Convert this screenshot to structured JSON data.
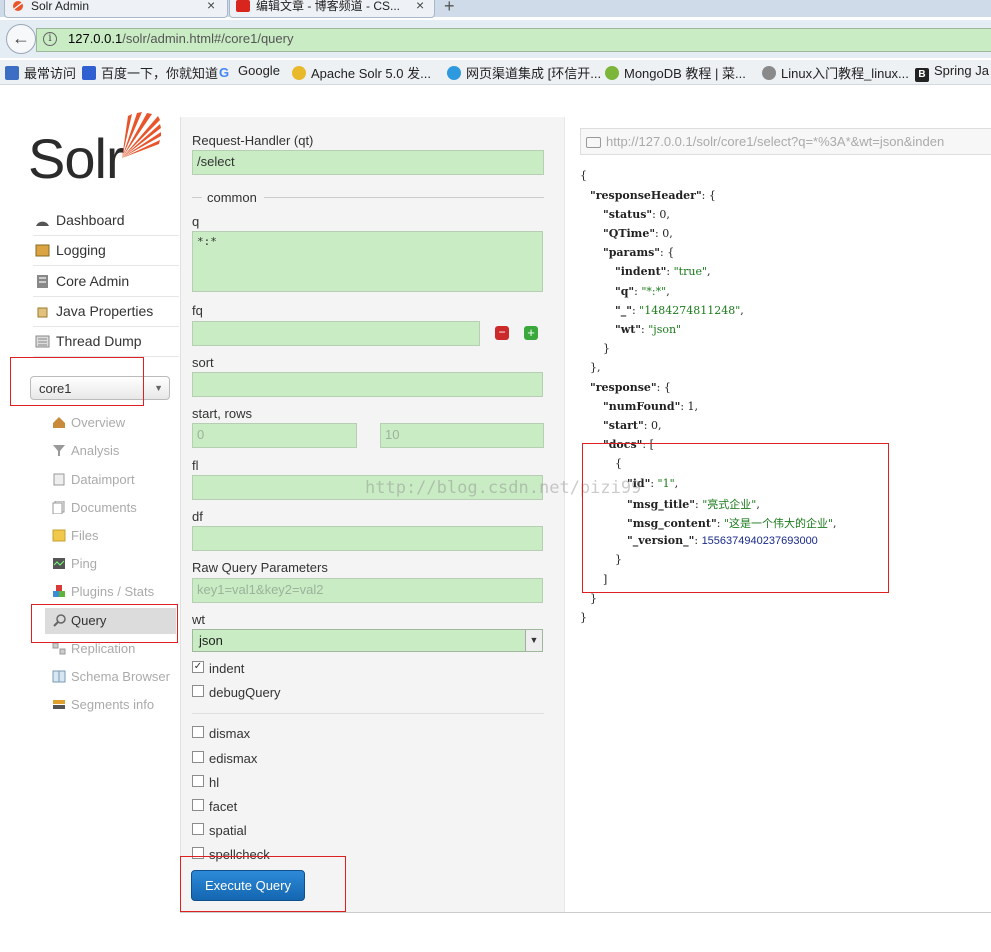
{
  "browser": {
    "tabs": [
      {
        "label": "Solr Admin",
        "close": "×"
      },
      {
        "label": "编辑文章 - 博客频道 - CS...",
        "close": "×"
      }
    ],
    "new_tab": "+",
    "url_host": "127.0.0.1",
    "url_path": "/solr/admin.html#/core1/query",
    "bookmarks": [
      "最常访问",
      "百度一下，你就知道",
      "Google",
      "Apache Solr 5.0 发...",
      "网页渠道集成 [环信开...",
      "MongoDB 教程 | 菜...",
      "Linux入门教程_linux...",
      "Spring Ja"
    ]
  },
  "logo": {
    "text": "Solr"
  },
  "nav": {
    "items": [
      "Dashboard",
      "Logging",
      "Core Admin",
      "Java Properties",
      "Thread Dump"
    ],
    "core_select": "core1",
    "core_items": [
      "Overview",
      "Analysis",
      "Dataimport",
      "Documents",
      "Files",
      "Ping",
      "Plugins / Stats",
      "Query",
      "Replication",
      "Schema Browser",
      "Segments info"
    ]
  },
  "form": {
    "request_handler_label": "Request-Handler (qt)",
    "request_handler_value": "/select",
    "common_label": "common",
    "q_label": "q",
    "q_value": "*:*",
    "fq_label": "fq",
    "sort_label": "sort",
    "start_rows_label": "start, rows",
    "start_value": "0",
    "rows_value": "10",
    "fl_label": "fl",
    "df_label": "df",
    "raw_label": "Raw Query Parameters",
    "raw_placeholder": "key1=val1&key2=val2",
    "wt_label": "wt",
    "wt_value": "json",
    "checkboxes": [
      {
        "label": "indent",
        "checked": true
      },
      {
        "label": "debugQuery",
        "checked": false
      },
      {
        "label": "dismax",
        "checked": false
      },
      {
        "label": "edismax",
        "checked": false
      },
      {
        "label": "hl",
        "checked": false
      },
      {
        "label": "facet",
        "checked": false
      },
      {
        "label": "spatial",
        "checked": false
      },
      {
        "label": "spellcheck",
        "checked": false
      }
    ],
    "execute_label": "Execute Query"
  },
  "result": {
    "url": "http://127.0.0.1/solr/core1/select?q=*%3A*&wt=json&inden",
    "response_time": "0",
    "status": "0",
    "params": {
      "indent": "\"true\"",
      "q": "\"*:*\"",
      "_": "\"1484274811248\"",
      "wt": "\"json\""
    },
    "num_found": "1",
    "start": "0",
    "doc": {
      "id": "\"1\"",
      "msg_title": "\"亮式企业\"",
      "msg_content": "\"这是一个伟大的企业\"",
      "_version_": "1556374940237693000"
    }
  },
  "watermark": "http://blog.csdn.net/pizi99"
}
